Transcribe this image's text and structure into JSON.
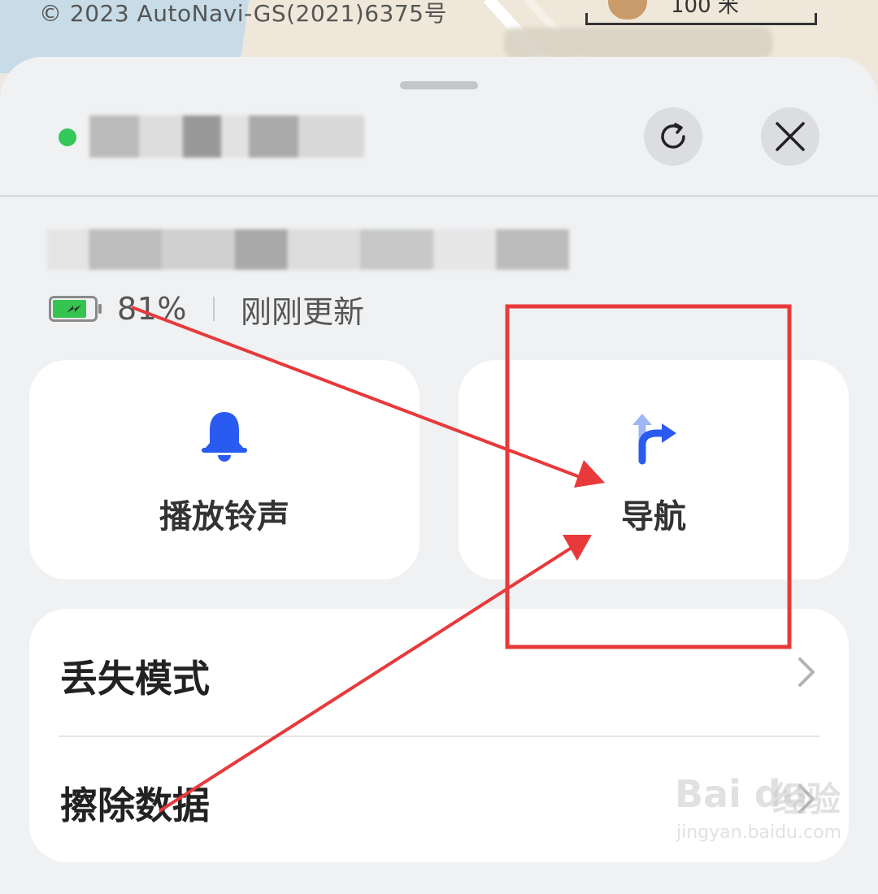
{
  "map": {
    "copyright": "© 2023 AutoNavi-GS(2021)6375号",
    "scale_label": "100 米"
  },
  "header": {
    "device_name": "",
    "status_color": "#34c759",
    "refresh_icon": "refresh-icon",
    "close_icon": "close-icon"
  },
  "status": {
    "address": "",
    "battery_percent": "81%",
    "battery_level": 0.81,
    "charging": true,
    "updated": "刚刚更新"
  },
  "actions": [
    {
      "label": "播放铃声",
      "icon": "bell-icon",
      "color": "#2a5bf0"
    },
    {
      "label": "导航",
      "icon": "navigation-turn-right-icon",
      "color": "#2a5bf0"
    }
  ],
  "list": [
    {
      "label": "丢失模式"
    },
    {
      "label": "擦除数据"
    }
  ],
  "annotation": {
    "color": "#e8393b"
  },
  "watermark": {
    "brand": "Bai du",
    "brand_cn": "经验",
    "url": "jingyan.baidu.com"
  }
}
